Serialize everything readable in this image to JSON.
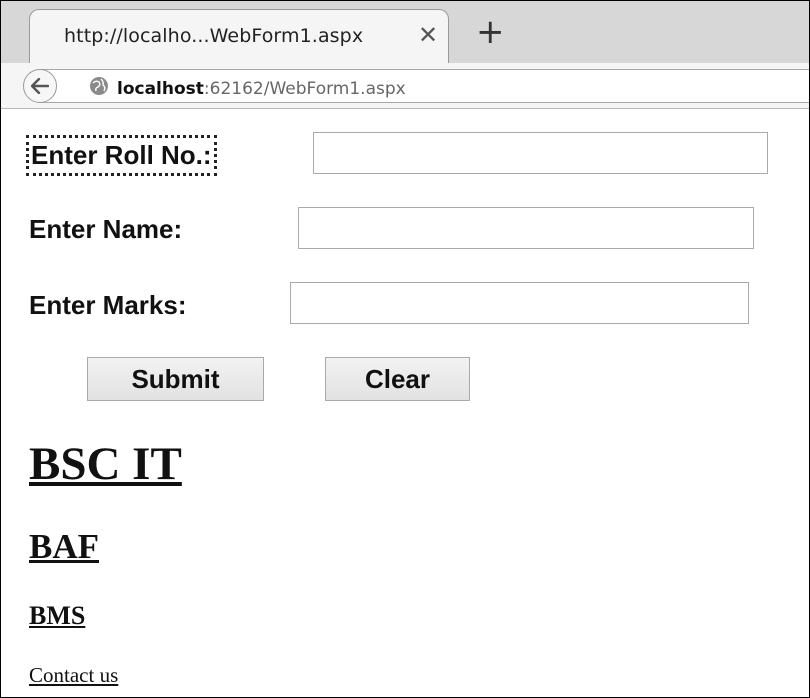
{
  "browser": {
    "tab_title": "http://localho...WebForm1.aspx",
    "url_host": "localhost",
    "url_rest": ":62162/WebForm1.aspx"
  },
  "form": {
    "roll_label": "Enter Roll No.:",
    "roll_value": "",
    "name_label": "Enter Name:",
    "name_value": "",
    "marks_label": "Enter Marks:",
    "marks_value": "",
    "submit_label": "Submit",
    "clear_label": "Clear"
  },
  "links": {
    "h1": "BSC IT",
    "h2": "BAF",
    "h3": "BMS",
    "contact": "Contact us"
  }
}
